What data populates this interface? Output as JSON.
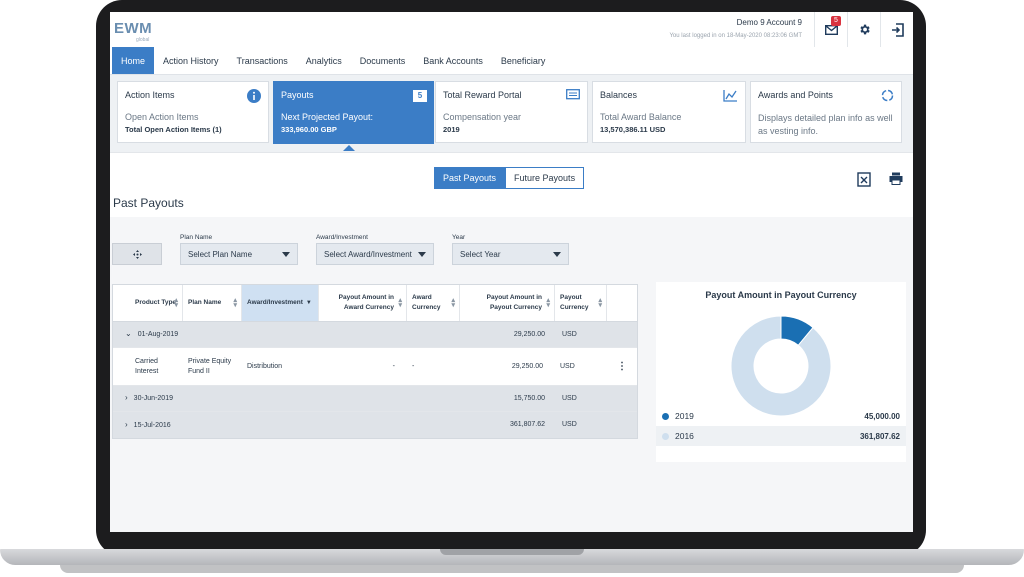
{
  "app": {
    "logo": "EWM",
    "logo_sub": "global",
    "account_name": "Demo 9 Account 9",
    "last_login": "You last logged in on 18-May-2020 08:23:06 GMT",
    "mail_count": "5"
  },
  "nav": {
    "items": [
      "Home",
      "Action History",
      "Transactions",
      "Analytics",
      "Documents",
      "Bank Accounts",
      "Beneficiary"
    ],
    "active": "Home"
  },
  "cards": {
    "action_items": {
      "title": "Action Items",
      "sub": "Open Action Items",
      "value": "Total Open Action Items (1)"
    },
    "payouts": {
      "title": "Payouts",
      "count": "5",
      "sub": "Next Projected Payout:",
      "value": "333,960.00 GBP"
    },
    "reward_portal": {
      "title": "Total Reward Portal",
      "sub": "Compensation year",
      "value": "2019"
    },
    "balances": {
      "title": "Balances",
      "sub": "Total Award Balance",
      "value": "13,570,386.11 USD"
    },
    "awards": {
      "title": "Awards and Points",
      "desc": "Displays detailed plan info as well as vesting info."
    }
  },
  "main": {
    "toggle": {
      "past": "Past Payouts",
      "future": "Future Payouts",
      "active": "past"
    },
    "section_title": "Past Payouts",
    "filters": {
      "plan": {
        "label": "Plan Name",
        "placeholder": "Select Plan Name"
      },
      "award": {
        "label": "Award/Investment",
        "placeholder": "Select Award/Investment"
      },
      "year": {
        "label": "Year",
        "placeholder": "Select Year"
      }
    }
  },
  "table": {
    "headers": [
      "Product Type",
      "Plan Name",
      "Award/Investment",
      "Payout Amount in Award Currency",
      "Award Currency",
      "Payout Amount in Payout Currency",
      "Payout Currency"
    ],
    "rows": [
      {
        "kind": "group",
        "expanded": true,
        "date": "01-Aug-2019",
        "payout_amount": "29,250.00",
        "payout_currency": "USD"
      },
      {
        "kind": "detail",
        "product_type": "Carried Interest",
        "plan_name": "Private Equity Fund II",
        "award": "Distribution",
        "amount_award": "-",
        "award_currency": "-",
        "payout_amount": "29,250.00",
        "payout_currency": "USD"
      },
      {
        "kind": "group",
        "expanded": false,
        "date": "30-Jun-2019",
        "payout_amount": "15,750.00",
        "payout_currency": "USD"
      },
      {
        "kind": "group",
        "expanded": false,
        "date": "15-Jul-2016",
        "payout_amount": "361,807.62",
        "payout_currency": "USD"
      }
    ]
  },
  "chart_data": {
    "type": "pie",
    "title": "Payout Amount in Payout Currency",
    "categories": [
      "2019",
      "2016"
    ],
    "values": [
      45000.0,
      361807.62
    ],
    "value_labels": [
      "45,000.00",
      "361,807.62"
    ],
    "colors": [
      "#1a6fb3",
      "#cfdfee"
    ],
    "donut": true,
    "legend": "bottom"
  }
}
